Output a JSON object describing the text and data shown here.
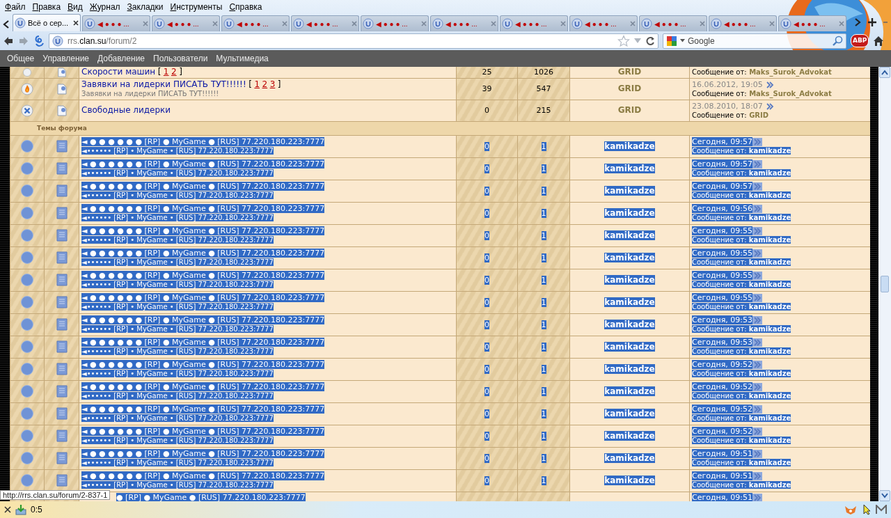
{
  "menu": [
    {
      "label": "Файл"
    },
    {
      "label": "Правка"
    },
    {
      "label": "Вид"
    },
    {
      "label": "Журнал"
    },
    {
      "label": "Закладки"
    },
    {
      "label": "Инструменты"
    },
    {
      "label": "Справка"
    }
  ],
  "tabs": [
    {
      "label": "Всё о сер...",
      "selected": true
    },
    {
      "label": "◀ ● ● ● ...",
      "selected": false
    },
    {
      "label": "◀ ● ● ● ...",
      "selected": false
    },
    {
      "label": "◀ ● ● ● ...",
      "selected": false
    },
    {
      "label": "◀ ● ● ● ...",
      "selected": false
    },
    {
      "label": "◀ ● ● ● ...",
      "selected": false
    },
    {
      "label": "◀ ● ● ● ...",
      "selected": false
    },
    {
      "label": "◀ ● ● ● ...",
      "selected": false
    },
    {
      "label": "◀ ● ● ● ...",
      "selected": false
    },
    {
      "label": "◀ ● ● ● ...",
      "selected": false
    },
    {
      "label": "◀ ● ● ● ...",
      "selected": false
    },
    {
      "label": "◀ ● ● ● ...",
      "selected": false
    }
  ],
  "address": {
    "prefix": "rrs.",
    "domain": "clan.su",
    "path": "/forum/2"
  },
  "search": {
    "placeholder": "Google"
  },
  "addon_badge": "ABP",
  "site_menu": [
    {
      "label": "Общее"
    },
    {
      "label": "Управление"
    },
    {
      "label": "Добавление"
    },
    {
      "label": "Пользователи"
    },
    {
      "label": "Мультимедиа"
    }
  ],
  "forums": [
    {
      "kind": "plain",
      "title": "Скорости машин",
      "pages_open": "[",
      "pages": [
        "1",
        "2"
      ],
      "pages_close": "]",
      "threads": "25",
      "posts": "1026",
      "author": "GRID",
      "last_label": "Сообщение от:",
      "last_by": "Maks_Surok_Advokat"
    },
    {
      "kind": "hot",
      "title": "Завявки на лидерки ПИСАТЬ ТУТ!!!!!!",
      "pages_open": "[",
      "pages": [
        "1",
        "2",
        "3"
      ],
      "pages_close": "]",
      "description": "Завявки на лидерки ПИСАТЬ ТУТ!!!!!!",
      "threads": "39",
      "posts": "547",
      "author": "GRID",
      "last_date": "16.06.2012, 19:05",
      "last_label": "Сообщение от:",
      "last_by": "Maks_Surok_Advokat"
    },
    {
      "kind": "closed",
      "title": "Свободные лидерки",
      "threads": "0",
      "posts": "215",
      "author": "GRID",
      "last_date": "23.08.2010, 18:07",
      "last_label": "Сообщение от:",
      "last_by": "GRID"
    }
  ],
  "section_title": "Темы форума",
  "topics": [
    {
      "title": "◄ ● ● ● ● ● ● [RP] ● MyGame ● [RUS] 77.220.180.223:7777",
      "subtitle": "◄•••••• [RP] • MyGame • [RUS] 77.220.180.223:7777",
      "replies": "0",
      "views": "1",
      "author": "kamikadze",
      "last_date": "Сегодня, 09:57",
      "last_label": "Сообщение от:",
      "last_by": "kamikadze",
      "selected": true
    },
    {
      "title": "◄ ● ● ● ● ● ● [RP] ● MyGame ● [RUS] 77.220.180.223:7777",
      "subtitle": "◄•••••• [RP] • MyGame • [RUS] 77.220.180.223:7777",
      "replies": "0",
      "views": "1",
      "author": "kamikadze",
      "last_date": "Сегодня, 09:57",
      "last_label": "Сообщение от:",
      "last_by": "kamikadze",
      "selected": true
    },
    {
      "title": "◄ ● ● ● ● ● ● [RP] ● MyGame ● [RUS] 77.220.180.223:7777",
      "subtitle": "◄•••••• [RP] • MyGame • [RUS] 77.220.180.223:7777",
      "replies": "0",
      "views": "1",
      "author": "kamikadze",
      "last_date": "Сегодня, 09:57",
      "last_label": "Сообщение от:",
      "last_by": "kamikadze",
      "selected": true
    },
    {
      "title": "◄ ● ● ● ● ● ● [RP] ● MyGame ● [RUS] 77.220.180.223:7777",
      "subtitle": "◄•••••• [RP] • MyGame • [RUS] 77.220.180.223:7777",
      "replies": "0",
      "views": "1",
      "author": "kamikadze",
      "last_date": "Сегодня, 09:56",
      "last_label": "Сообщение от:",
      "last_by": "kamikadze",
      "selected": true
    },
    {
      "title": "◄ ● ● ● ● ● ● [RP] ● MyGame ● [RUS] 77.220.180.223:7777",
      "subtitle": "◄•••••• [RP] • MyGame • [RUS] 77.220.180.223:7777",
      "replies": "0",
      "views": "1",
      "author": "kamikadze",
      "last_date": "Сегодня, 09:55",
      "last_label": "Сообщение от:",
      "last_by": "kamikadze",
      "selected": true
    },
    {
      "title": "◄ ● ● ● ● ● ● [RP] ● MyGame ● [RUS] 77.220.180.223:7777",
      "subtitle": "◄•••••• [RP] • MyGame • [RUS] 77.220.180.223:7777",
      "replies": "0",
      "views": "1",
      "author": "kamikadze",
      "last_date": "Сегодня, 09:55",
      "last_label": "Сообщение от:",
      "last_by": "kamikadze",
      "selected": true
    },
    {
      "title": "◄ ● ● ● ● ● ● [RP] ● MyGame ● [RUS] 77.220.180.223:7777",
      "subtitle": "◄•••••• [RP] • MyGame • [RUS] 77.220.180.223:7777",
      "replies": "0",
      "views": "1",
      "author": "kamikadze",
      "last_date": "Сегодня, 09:55",
      "last_label": "Сообщение от:",
      "last_by": "kamikadze",
      "selected": true
    },
    {
      "title": "◄ ● ● ● ● ● ● [RP] ● MyGame ● [RUS] 77.220.180.223:7777",
      "subtitle": "◄•••••• [RP] • MyGame • [RUS] 77.220.180.223:7777",
      "replies": "0",
      "views": "1",
      "author": "kamikadze",
      "last_date": "Сегодня, 09:55",
      "last_label": "Сообщение от:",
      "last_by": "kamikadze",
      "selected": true
    },
    {
      "title": "◄ ● ● ● ● ● ● [RP] ● MyGame ● [RUS] 77.220.180.223:7777",
      "subtitle": "◄•••••• [RP] • MyGame • [RUS] 77.220.180.223:7777",
      "replies": "0",
      "views": "1",
      "author": "kamikadze",
      "last_date": "Сегодня, 09:53",
      "last_label": "Сообщение от:",
      "last_by": "kamikadze",
      "selected": true
    },
    {
      "title": "◄ ● ● ● ● ● ● [RP] ● MyGame ● [RUS] 77.220.180.223:7777",
      "subtitle": "◄•••••• [RP] • MyGame • [RUS] 77.220.180.223:7777",
      "replies": "0",
      "views": "1",
      "author": "kamikadze",
      "last_date": "Сегодня, 09:53",
      "last_label": "Сообщение от:",
      "last_by": "kamikadze",
      "selected": true
    },
    {
      "title": "◄ ● ● ● ● ● ● [RP] ● MyGame ● [RUS] 77.220.180.223:7777",
      "subtitle": "◄•••••• [RP] • MyGame • [RUS] 77.220.180.223:7777",
      "replies": "0",
      "views": "1",
      "author": "kamikadze",
      "last_date": "Сегодня, 09:52",
      "last_label": "Сообщение от:",
      "last_by": "kamikadze",
      "selected": true
    },
    {
      "title": "◄ ● ● ● ● ● ● [RP] ● MyGame ● [RUS] 77.220.180.223:7777",
      "subtitle": "◄•••••• [RP] • MyGame • [RUS] 77.220.180.223:7777",
      "replies": "0",
      "views": "1",
      "author": "kamikadze",
      "last_date": "Сегодня, 09:52",
      "last_label": "Сообщение от:",
      "last_by": "kamikadze",
      "selected": true
    },
    {
      "title": "◄ ● ● ● ● ● ● [RP] ● MyGame ● [RUS] 77.220.180.223:7777",
      "subtitle": "◄•••••• [RP] • MyGame • [RUS] 77.220.180.223:7777",
      "replies": "0",
      "views": "1",
      "author": "kamikadze",
      "last_date": "Сегодня, 09:52",
      "last_label": "Сообщение от:",
      "last_by": "kamikadze",
      "selected": true
    },
    {
      "title": "◄ ● ● ● ● ● ● [RP] ● MyGame ● [RUS] 77.220.180.223:7777",
      "subtitle": "◄•••••• [RP] • MyGame • [RUS] 77.220.180.223:7777",
      "replies": "0",
      "views": "1",
      "author": "kamikadze",
      "last_date": "Сегодня, 09:52",
      "last_label": "Сообщение от:",
      "last_by": "kamikadze",
      "selected": true
    },
    {
      "title": "◄ ● ● ● ● ● ● [RP] ● MyGame ● [RUS] 77.220.180.223:7777",
      "subtitle": "◄•••••• [RP] • MyGame • [RUS] 77.220.180.223:7777",
      "replies": "0",
      "views": "1",
      "author": "kamikadze",
      "last_date": "Сегодня, 09:51",
      "last_label": "Сообщение от:",
      "last_by": "kamikadze",
      "selected": true
    },
    {
      "title": "◄ ● ● ● ● ● ● [RP] ● MyGame ● [RUS] 77.220.180.223:7777",
      "subtitle": "◄•••••• [RP] • MyGame • [RUS] 77.220.180.223:7777",
      "replies": "0",
      "views": "1",
      "author": "kamikadze",
      "last_date": "Сегодня, 09:51",
      "last_label": "Сообщение от:",
      "last_by": "kamikadze",
      "selected": true
    },
    {
      "title": "● [RP] ● MyGame ● [RUS] 77.220.180.223:7777",
      "last_date": "Сегодня, 09:51",
      "selected": true
    }
  ],
  "tooltip": "http://rrs.clan.su/forum/2-837-1",
  "status": "0:5"
}
